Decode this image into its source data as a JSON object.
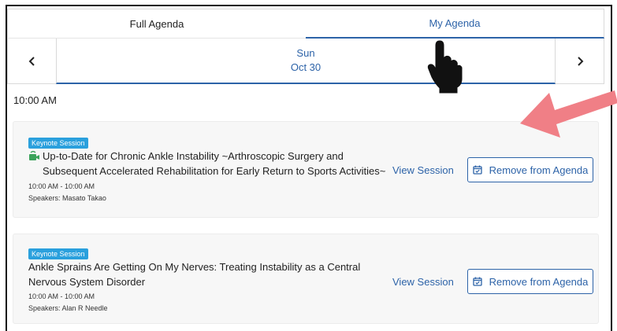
{
  "tabs": [
    {
      "label": "Full Agenda",
      "active": false
    },
    {
      "label": "My Agenda",
      "active": true
    }
  ],
  "date_nav": {
    "prev_icon": "chevron-left",
    "next_icon": "chevron-right",
    "weekday": "Sun",
    "date": "Oct 30"
  },
  "time_slot": "10:00 AM",
  "sessions": [
    {
      "badge": "Keynote Session",
      "title_line1": "Up-to-Date for Chronic Ankle Instability ~Arthroscopic Surgery and",
      "title_line2": "Subsequent Accelerated Rehabilitation for Early Return to Sports Activities~",
      "has_live_icon": true,
      "time_range": "10:00 AM - 10:00 AM",
      "speakers": "Speakers: Masato Takao",
      "view_label": "View Session",
      "remove_label": "Remove from Agenda"
    },
    {
      "badge": "Keynote Session",
      "title_line1": "Ankle Sprains Are Getting On My Nerves: Treating Instability as a Central",
      "title_line2": "Nervous System Disorder",
      "has_live_icon": false,
      "time_range": "10:00 AM - 10:00 AM",
      "speakers": "Speakers: Alan R Needle",
      "view_label": "View Session",
      "remove_label": "Remove from Agenda"
    }
  ],
  "colors": {
    "accent": "#2d63a8",
    "badge": "#2aa0dd",
    "annotation_arrow": "#f07f86",
    "live_icon": "#3aa35a"
  }
}
